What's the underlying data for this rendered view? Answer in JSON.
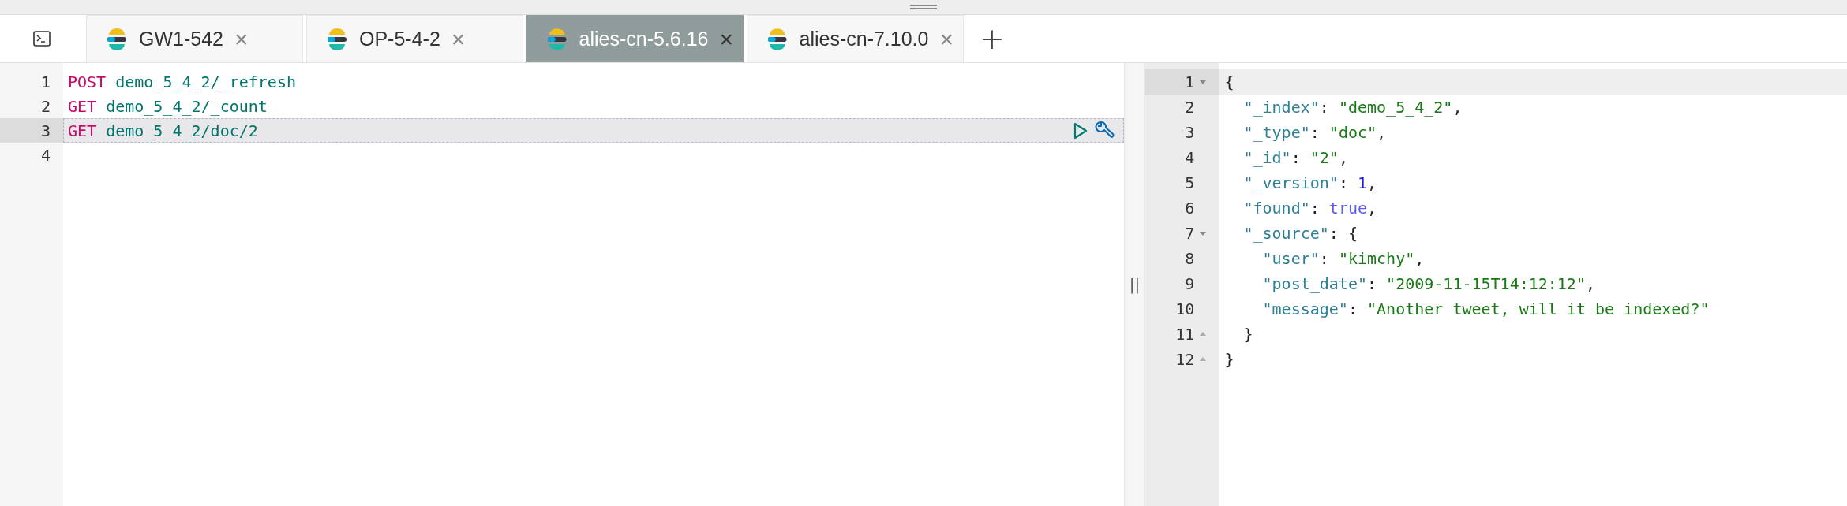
{
  "tabs": [
    {
      "label": "GW1-542",
      "close": "×",
      "selected": false
    },
    {
      "label": "OP-5-4-2",
      "close": "×",
      "selected": false
    },
    {
      "label": "alies-cn-5.6.16",
      "close": "×",
      "selected": true
    },
    {
      "label": "alies-cn-7.10.0",
      "close": "×",
      "selected": false
    }
  ],
  "add_tab": "+",
  "request_editor": {
    "lines": [
      {
        "number": "1",
        "selected": false,
        "tokens": [
          {
            "kind": "method",
            "text": "POST"
          },
          {
            "kind": "path",
            "text": " demo_5_4_2/_refresh"
          }
        ]
      },
      {
        "number": "2",
        "selected": false,
        "tokens": [
          {
            "kind": "method",
            "text": "GET"
          },
          {
            "kind": "path",
            "text": " demo_5_4_2/_count"
          }
        ]
      },
      {
        "number": "3",
        "selected": true,
        "tokens": [
          {
            "kind": "method",
            "text": "GET"
          },
          {
            "kind": "path",
            "text": " demo_5_4_2/doc/2"
          }
        ]
      },
      {
        "number": "4",
        "selected": false
      }
    ]
  },
  "splitter": "||",
  "response_viewer": {
    "lines": [
      {
        "number": "1",
        "fold_start": true,
        "selected": true,
        "tokens": [
          {
            "kind": "punct",
            "text": "{"
          }
        ]
      },
      {
        "number": "2",
        "selected": false,
        "tokens": [
          {
            "kind": "key",
            "text": "  \"_index\""
          },
          {
            "kind": "punct",
            "text": ": "
          },
          {
            "kind": "string",
            "text": "\"demo_5_4_2\""
          },
          {
            "kind": "punct",
            "text": ","
          }
        ]
      },
      {
        "number": "3",
        "selected": false,
        "tokens": [
          {
            "kind": "key",
            "text": "  \"_type\""
          },
          {
            "kind": "punct",
            "text": ": "
          },
          {
            "kind": "string",
            "text": "\"doc\""
          },
          {
            "kind": "punct",
            "text": ","
          }
        ]
      },
      {
        "number": "4",
        "selected": false,
        "tokens": [
          {
            "kind": "key",
            "text": "  \"_id\""
          },
          {
            "kind": "punct",
            "text": ": "
          },
          {
            "kind": "string",
            "text": "\"2\""
          },
          {
            "kind": "punct",
            "text": ","
          }
        ]
      },
      {
        "number": "5",
        "selected": false,
        "tokens": [
          {
            "kind": "key",
            "text": "  \"_version\""
          },
          {
            "kind": "punct",
            "text": ": "
          },
          {
            "kind": "number",
            "text": "1"
          },
          {
            "kind": "punct",
            "text": ","
          }
        ]
      },
      {
        "number": "6",
        "selected": false,
        "tokens": [
          {
            "kind": "key",
            "text": "  \"found\""
          },
          {
            "kind": "punct",
            "text": ": "
          },
          {
            "kind": "boolean",
            "text": "true"
          },
          {
            "kind": "punct",
            "text": ","
          }
        ]
      },
      {
        "number": "7",
        "fold_start": true,
        "selected": false,
        "tokens": [
          {
            "kind": "key",
            "text": "  \"_source\""
          },
          {
            "kind": "punct",
            "text": ": {"
          }
        ]
      },
      {
        "number": "8",
        "selected": false,
        "tokens": [
          {
            "kind": "key",
            "text": "    \"user\""
          },
          {
            "kind": "punct",
            "text": ": "
          },
          {
            "kind": "string",
            "text": "\"kimchy\""
          },
          {
            "kind": "punct",
            "text": ","
          }
        ]
      },
      {
        "number": "9",
        "selected": false,
        "tokens": [
          {
            "kind": "key",
            "text": "    \"post_date\""
          },
          {
            "kind": "punct",
            "text": ": "
          },
          {
            "kind": "string",
            "text": "\"2009-11-15T14:12:12\""
          },
          {
            "kind": "punct",
            "text": ","
          }
        ]
      },
      {
        "number": "10",
        "selected": false,
        "tokens": [
          {
            "kind": "key",
            "text": "    \"message\""
          },
          {
            "kind": "punct",
            "text": ": "
          },
          {
            "kind": "string",
            "text": "\"Another tweet, will it be indexed?\""
          }
        ]
      },
      {
        "number": "11",
        "fold_end": true,
        "selected": false,
        "tokens": [
          {
            "kind": "punct",
            "text": "  }"
          }
        ]
      },
      {
        "number": "12",
        "fold_end": true,
        "selected": false,
        "tokens": [
          {
            "kind": "punct",
            "text": "}"
          }
        ]
      }
    ]
  }
}
